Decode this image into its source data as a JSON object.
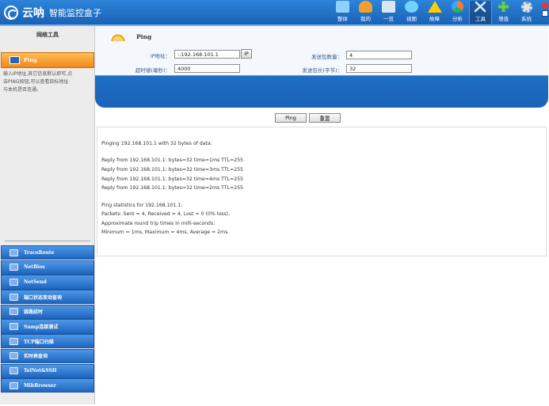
{
  "header": {
    "brand": "云呐",
    "title": "智能监控盒子",
    "nav": [
      {
        "label": "整体",
        "icon": "monitor-icon",
        "color": "#8fd0ff"
      },
      {
        "label": "我的",
        "icon": "user-icon",
        "color": "#f0a030"
      },
      {
        "label": "一览",
        "icon": "overview-icon",
        "color": "#d9e6f5"
      },
      {
        "label": "视图",
        "icon": "view-icon",
        "color": "#6fd2ff"
      },
      {
        "label": "故障",
        "icon": "warning-icon",
        "color": "#ffcc00"
      },
      {
        "label": "分析",
        "icon": "pie-chart-icon",
        "color": "#ff7b2e"
      },
      {
        "label": "工具",
        "icon": "tools-icon",
        "color": "#d9e3ef"
      },
      {
        "label": "增值",
        "icon": "plus-icon",
        "color": "#67d33a"
      },
      {
        "label": "系统",
        "icon": "gear-icon",
        "color": "#dfe6ee"
      }
    ]
  },
  "sidebar": {
    "title": "网络工具",
    "active": {
      "label": "Ping",
      "icon": "monitor-icon"
    },
    "description": [
      "输入IP地址,其它信息默认即可,点",
      "击PING按钮,可以查看目标地址",
      "与本机是否连通。"
    ],
    "items": [
      {
        "label": "TraceRoute",
        "icon": "route-icon"
      },
      {
        "label": "NetBios",
        "icon": "netbios-icon"
      },
      {
        "label": "NetSend",
        "icon": "send-icon"
      },
      {
        "label": "端口状态变动查询",
        "icon": "port-icon"
      },
      {
        "label": "链路延时",
        "icon": "headset-icon"
      },
      {
        "label": "Snmp连接测试",
        "icon": "gear-icon"
      },
      {
        "label": "TCP端口扫描",
        "icon": "scan-icon"
      },
      {
        "label": "实时表查询",
        "icon": "table-icon"
      },
      {
        "label": "TelNet&SSH",
        "icon": "terminal-icon"
      },
      {
        "label": "MibBrowser",
        "icon": "browser-icon"
      }
    ]
  },
  "ping": {
    "title": "Ping",
    "ip_label": "IP地址：",
    "ip_value": "::192.168.101.1",
    "ip_button": "IP",
    "timeout_label": "超时値(毫秒)：",
    "timeout_value": "4000",
    "count_label": "发送包数量：",
    "count_value": "4",
    "size_label": "发送包长(字节)：",
    "size_value": "32",
    "ping_button": "Ping",
    "reset_button": "重置"
  },
  "output": {
    "lines": [
      "Pinging 192.168.101.1 with 32 bytes of data:",
      "",
      "Reply from 192.168.101.1: bytes=32 time=1ms TTL=255",
      "Reply from 192.168.101.1: bytes=32 time=3ms TTL=255",
      "Reply from 192.168.101.1: bytes=32 time=4ms TTL=255",
      "Reply from 192.168.101.1: bytes=32 time=2ms TTL=255",
      "",
      "Ping statistics for 192.168.101.1:",
      "Packets: Sent = 4, Received = 4, Lost = 0 (0% loss),",
      "Approximate round trip times in milli-seconds:",
      "Minimum = 1ms, Maximum = 4ms, Average = 2ms"
    ]
  }
}
